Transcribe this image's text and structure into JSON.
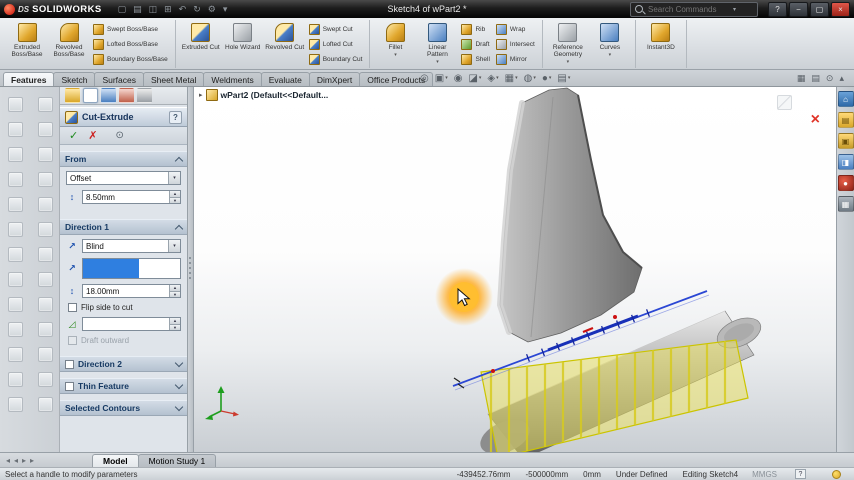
{
  "window": {
    "logo_prefix": "DS",
    "logo": "SOLIDWORKS",
    "title": "Sketch4 of wPart2 *",
    "search_placeholder": "Search Commands"
  },
  "window_controls": {
    "help": "?",
    "minimize": "−",
    "maximize": "▢",
    "close": "×"
  },
  "title_icons": [
    {
      "name": "new",
      "glyph": "▢"
    },
    {
      "name": "open",
      "glyph": "▤"
    },
    {
      "name": "save",
      "glyph": "◫"
    },
    {
      "name": "print",
      "glyph": "⊞"
    },
    {
      "name": "undo",
      "glyph": "↶"
    },
    {
      "name": "rebuild",
      "glyph": "↻"
    },
    {
      "name": "options",
      "glyph": "⚙"
    },
    {
      "name": "more",
      "glyph": "▾"
    }
  ],
  "glyphs": {
    "caret": "▾",
    "ok": "✓",
    "cancel": "✗",
    "eye": "⊙",
    "expander": "▸",
    "nav_left": "◂",
    "nav_right": "▸"
  },
  "tabs": [
    "Features",
    "Sketch",
    "Surfaces",
    "Sheet Metal",
    "Weldments",
    "Evaluate",
    "DimXpert",
    "Office Products"
  ],
  "ribbon": {
    "g1_large": [
      "Extruded Boss/Base",
      "Revolved Boss/Base"
    ],
    "g1_small": [
      "Swept Boss/Base",
      "Lofted Boss/Base",
      "Boundary Boss/Base"
    ],
    "g2_large": [
      "Extruded Cut",
      "Hole Wizard",
      "Revolved Cut"
    ],
    "g2_small": [
      "Swept Cut",
      "Lofted Cut",
      "Boundary Cut"
    ],
    "g3_large": [
      "Fillet",
      "Linear Pattern"
    ],
    "g3_small": [
      "Rib",
      "Draft",
      "Shell"
    ],
    "g3_small2": [
      "Wrap",
      "Intersect",
      "Mirror"
    ],
    "g4_large": [
      "Reference Geometry",
      "Curves"
    ],
    "g5_large": [
      "Instant3D"
    ]
  },
  "hud_icons": [
    {
      "name": "zoom-fit",
      "glyph": "◎"
    },
    {
      "name": "zoom-area",
      "glyph": "▣"
    },
    {
      "name": "previous-view",
      "glyph": "◉"
    },
    {
      "name": "section-view",
      "glyph": "◪"
    },
    {
      "name": "view-orientation",
      "glyph": "◈"
    },
    {
      "name": "display-style",
      "glyph": "▦"
    },
    {
      "name": "hide-show-items",
      "glyph": "◍"
    },
    {
      "name": "edit-appearance",
      "glyph": "●"
    },
    {
      "name": "apply-scene",
      "glyph": "▤"
    }
  ],
  "tabright_icons": [
    {
      "name": "show-panes",
      "glyph": "▦"
    },
    {
      "name": "show-toolbar",
      "glyph": "▤"
    },
    {
      "name": "pin-commandmanager",
      "glyph": "⊙"
    },
    {
      "name": "collapse-ribbon",
      "glyph": "▴"
    }
  ],
  "pm": {
    "title": "Cut-Extrude",
    "help": "?",
    "from": {
      "label": "From",
      "combo": "Offset",
      "value": "8.50mm"
    },
    "dir1": {
      "label": "Direction 1",
      "combo": "Blind",
      "depth": "18.00mm",
      "flip": "Flip side to cut",
      "draft_angle": "",
      "draft": "Draft outward"
    },
    "dir2": {
      "label": "Direction 2"
    },
    "thin": {
      "label": "Thin Feature"
    },
    "contours": {
      "label": "Selected Contours"
    },
    "icons": {
      "direction": "↗",
      "depth": "↕",
      "offset": "↕",
      "draft": "◿"
    }
  },
  "viewport": {
    "tree_label": "wPart2  (Default<<Default...",
    "confirm_close": "×"
  },
  "taskpane_icons": [
    {
      "name": "resources",
      "glyph": "⌂"
    },
    {
      "name": "design-library",
      "glyph": "▤"
    },
    {
      "name": "file-explorer",
      "glyph": "▣"
    },
    {
      "name": "view-palette",
      "glyph": "◨"
    },
    {
      "name": "appearances",
      "glyph": "●"
    },
    {
      "name": "custom-properties",
      "glyph": "▦"
    }
  ],
  "bottom": {
    "model_tab": "Model",
    "motion_tab": "Motion Study 1"
  },
  "status": {
    "message": "Select a handle to modify parameters",
    "x": "-439452.76mm",
    "y": "-500000mm",
    "z": "0mm",
    "state": "Under Defined",
    "mode": "Editing Sketch4",
    "units": "MMGS"
  },
  "colors": {
    "preview": "#e8dc3c",
    "sketch": "#2b47d4",
    "highlight": "#ffaa1e",
    "close_red": "#e03428"
  }
}
